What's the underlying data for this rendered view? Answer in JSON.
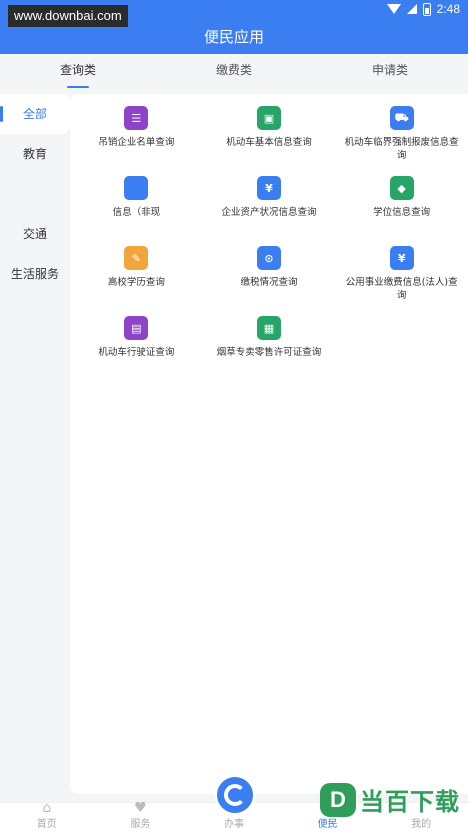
{
  "status": {
    "watermark": "www.downbai.com",
    "time": "2:48"
  },
  "header": {
    "title": "便民应用"
  },
  "tabs": [
    {
      "label": "查询类",
      "active": true
    },
    {
      "label": "缴费类",
      "active": false
    },
    {
      "label": "申请类",
      "active": false
    }
  ],
  "sidebar": {
    "items": [
      {
        "label": "全部",
        "active": true
      },
      {
        "label": "教育",
        "active": false
      },
      {
        "label": "",
        "active": false
      },
      {
        "label": "交通",
        "active": false
      },
      {
        "label": "生活服务",
        "active": false
      }
    ]
  },
  "apps": [
    {
      "name": "吊销企业名单查询",
      "color": "#8e44c9",
      "glyph": "☰",
      "icon": "list-icon"
    },
    {
      "name": "机动车基本信息查询",
      "color": "#27a567",
      "glyph": "▣",
      "icon": "car-info-icon"
    },
    {
      "name": "机动车临界强制报废信息查询",
      "color": "#3b7ef1",
      "glyph": "⛟",
      "icon": "car-icon"
    },
    {
      "name": "信息（非现",
      "color": "#3b7ef1",
      "glyph": "",
      "icon": "info-icon"
    },
    {
      "name": "企业资产状况信息查询",
      "color": "#3b7ef1",
      "glyph": "¥",
      "icon": "asset-icon"
    },
    {
      "name": "学位信息查询",
      "color": "#27a567",
      "glyph": "◆",
      "icon": "degree-icon"
    },
    {
      "name": "高校学历查询",
      "color": "#f2a53a",
      "glyph": "✎",
      "icon": "education-icon"
    },
    {
      "name": "缴税情况查询",
      "color": "#3b7ef1",
      "glyph": "⊙",
      "icon": "tax-icon"
    },
    {
      "name": "公用事业缴费信息(法人)查询",
      "color": "#3b7ef1",
      "glyph": "¥",
      "icon": "utility-icon"
    },
    {
      "name": "机动车行驶证查询",
      "color": "#8e44c9",
      "glyph": "▤",
      "icon": "license-icon"
    },
    {
      "name": "烟草专卖零售许可证查询",
      "color": "#27a567",
      "glyph": "▦",
      "icon": "permit-icon"
    }
  ],
  "bottom_nav": [
    {
      "label": "首页",
      "icon": "home-icon",
      "active": false
    },
    {
      "label": "服务",
      "icon": "heart-icon",
      "active": false
    },
    {
      "label": "办事",
      "icon": "office-icon",
      "active": false
    },
    {
      "label": "便民",
      "icon": "convenience-icon",
      "active": true
    },
    {
      "label": "我的",
      "icon": "user-icon",
      "active": false
    }
  ],
  "brand": {
    "logo": "D",
    "text": "当百下载"
  }
}
